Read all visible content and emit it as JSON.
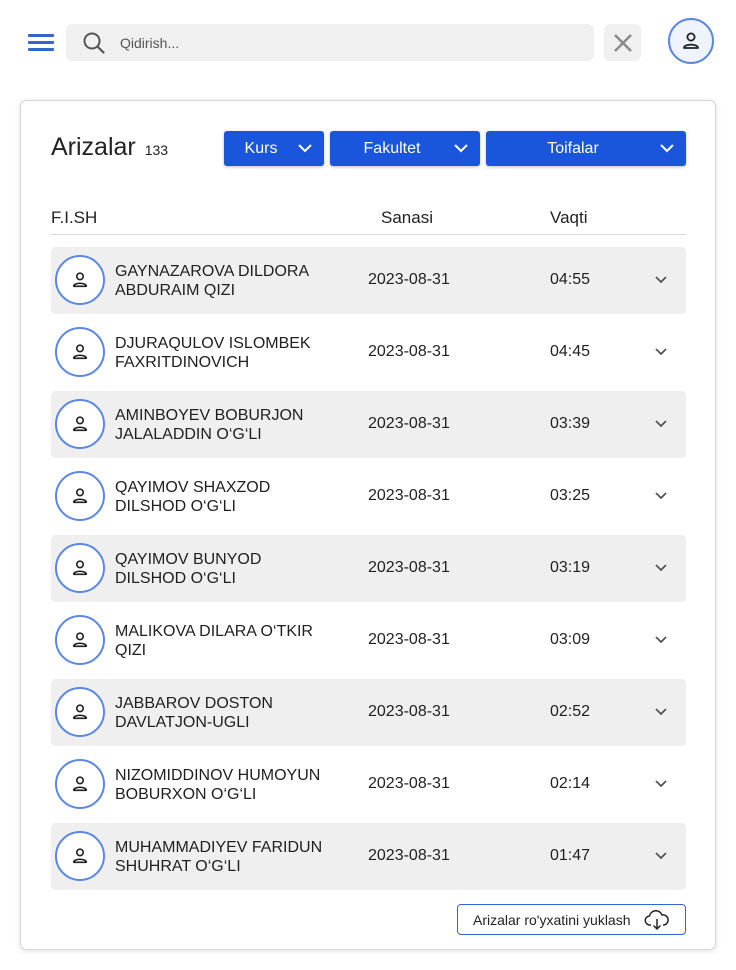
{
  "header": {
    "search_placeholder": "Qidirish..."
  },
  "card": {
    "title": "Arizalar",
    "count": "133",
    "filters": {
      "kurs": "Kurs",
      "fakultet": "Fakultet",
      "toifalar": "Toifalar"
    },
    "columns": {
      "name": "F.I.SH",
      "date": "Sanasi",
      "time": "Vaqti"
    },
    "rows": [
      {
        "name": "GAYNAZAROVA DILDORA ABDURAIM QIZI",
        "date": "2023-08-31",
        "time": "04:55"
      },
      {
        "name": "DJURAQULOV ISLOMBEK FAXRITDINOVICH",
        "date": "2023-08-31",
        "time": "04:45"
      },
      {
        "name": "AMINBOYEV BOBURJON JALALADDIN O‘G‘LI",
        "date": "2023-08-31",
        "time": "03:39"
      },
      {
        "name": "QAYIMOV SHAXZOD DILSHOD O‘G‘LI",
        "date": "2023-08-31",
        "time": "03:25"
      },
      {
        "name": "QAYIMOV BUNYOD DILSHOD O‘G‘LI",
        "date": "2023-08-31",
        "time": "03:19"
      },
      {
        "name": "MALIKOVA DILARA O‘TKIR QIZI",
        "date": "2023-08-31",
        "time": "03:09"
      },
      {
        "name": "JABBAROV DOSTON DAVLATJON-UGLI",
        "date": "2023-08-31",
        "time": "02:52"
      },
      {
        "name": "NIZOMIDDINOV HUMOYUN BOBURXON O‘G‘LI",
        "date": "2023-08-31",
        "time": "02:14"
      },
      {
        "name": "MUHAMMADIYEV FARIDUN SHUHRAT O‘G‘LI",
        "date": "2023-08-31",
        "time": "01:47"
      }
    ],
    "download_label": "Arizalar ro'yxatini yuklash"
  },
  "colors": {
    "accent": "#1a56db",
    "avatar_border": "#5b86e5",
    "row_shade": "#efefef"
  },
  "icons": {
    "menu": "hamburger-menu-icon",
    "search": "search-icon",
    "clear": "close-icon",
    "profile": "user-icon",
    "dropdown": "chevron-down-icon",
    "download": "cloud-download-icon"
  }
}
